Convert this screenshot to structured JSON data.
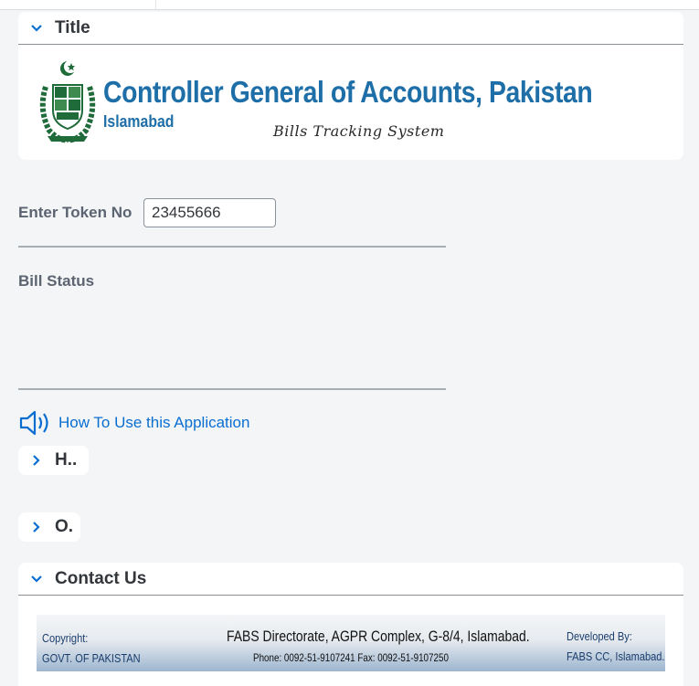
{
  "title_panel": {
    "title": "Title"
  },
  "banner": {
    "org_name": "Controller General of Accounts, Pakistan",
    "city": "Islamabad",
    "system_name": "Bills Tracking System"
  },
  "token": {
    "label": "Enter Token No",
    "value": "23455666"
  },
  "bill_status": {
    "label": "Bill Status"
  },
  "help_link": {
    "label": "How To Use this Application"
  },
  "collapsed_panels": [
    {
      "title": "H.."
    },
    {
      "title": "O."
    }
  ],
  "contact_panel": {
    "title": "Contact Us",
    "footer": {
      "copyright": "Copyright:",
      "copyright_owner": "GOVT. OF PAKISTAN",
      "address": "FABS Directorate, AGPR Complex, G-8/4, Islamabad.",
      "phone_fax": "Phone: 0092-51-9107241 Fax: 0092-51-9107250",
      "developed_by": "Developed By:",
      "developer": "FABS CC, Islamabad."
    }
  },
  "colors": {
    "accent": "#0a6ed1",
    "brand_blue": "#1e6ea8",
    "emblem_green": "#1f6b3a"
  }
}
